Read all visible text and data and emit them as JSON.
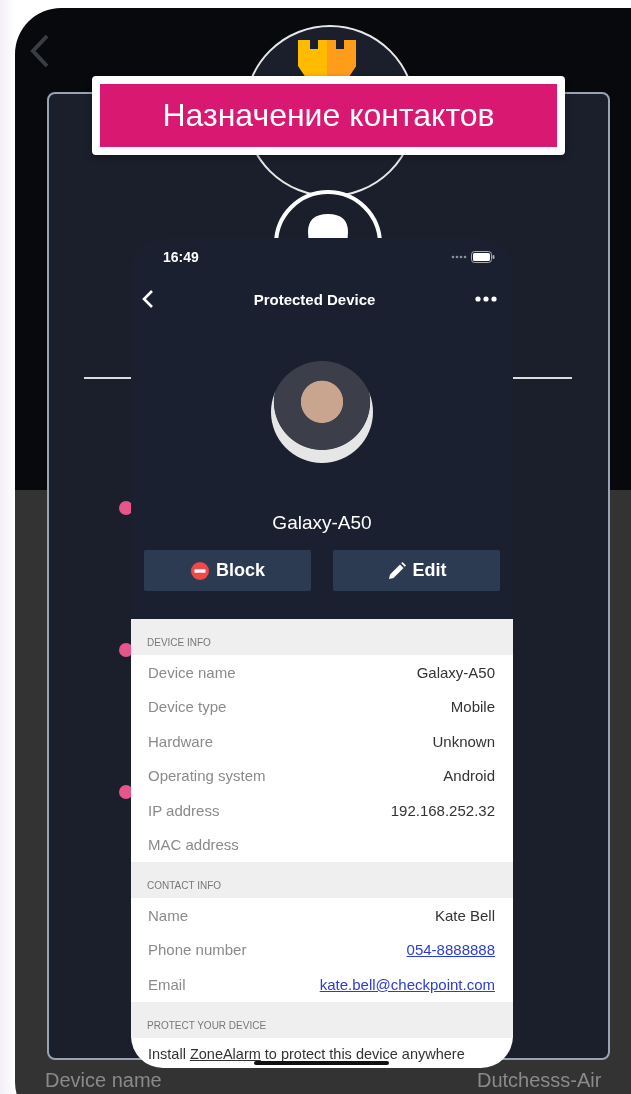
{
  "background_screen": {
    "bottom_row": {
      "label": "Device name",
      "value": "Dutchesss-Air"
    }
  },
  "banner": {
    "title": "Назначение контактов"
  },
  "device_screen": {
    "status_bar": {
      "time": "16:49"
    },
    "nav": {
      "title": "Protected Device"
    },
    "device_name": "Galaxy-A50",
    "actions": [
      {
        "kind": "block",
        "label": "Block"
      },
      {
        "kind": "edit",
        "label": "Edit"
      }
    ],
    "sections": [
      {
        "title": "DEVICE INFO",
        "rows": [
          {
            "label": "Device name",
            "value": "Galaxy-A50",
            "kind": "text"
          },
          {
            "label": "Device type",
            "value": "Mobile",
            "kind": "text"
          },
          {
            "label": "Hardware",
            "value": "Unknown",
            "kind": "text"
          },
          {
            "label": "Operating system",
            "value": "Android",
            "kind": "text"
          },
          {
            "label": "IP address",
            "value": "192.168.252.32",
            "kind": "text"
          },
          {
            "label": "MAC address"
          }
        ]
      },
      {
        "title": "CONTACT INFO",
        "rows": [
          {
            "label": "Name",
            "value": "Kate Bell",
            "kind": "text"
          },
          {
            "label": "Phone number",
            "value": "054-8888888",
            "kind": "link"
          },
          {
            "label": "Email",
            "value": "kate.bell@checkpoint.com",
            "kind": "link"
          }
        ]
      },
      {
        "title": "PROTECT YOUR DEVICE",
        "paragraph": {
          "before": "Install",
          "link": "ZoneAlarm",
          "after": "to protect this device anywhere"
        }
      }
    ]
  }
}
